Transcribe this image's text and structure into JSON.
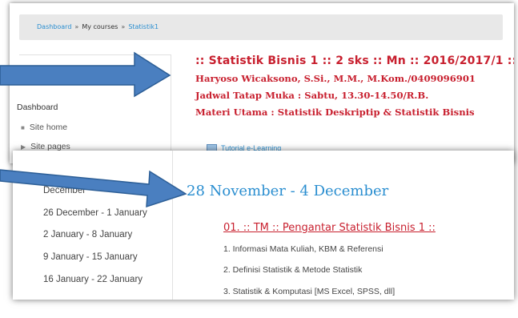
{
  "breadcrumb": {
    "items": [
      "Dashboard",
      "My courses",
      "Statistik1"
    ],
    "separator": "»"
  },
  "sidebar_top": {
    "title": "Dashboard",
    "items": [
      "Site home",
      "Site pages"
    ]
  },
  "course_header": {
    "title": ":: Statistik Bisnis 1 :: 2 sks :: Mn :: 2016/2017/1 ::",
    "lecturer": "Haryoso Wicaksono, S.Si., M.M., M.Kom./0409096901",
    "schedule": "Jadwal Tatap Muka : Sabtu, 13.30-14.50/R.B.",
    "material": "Materi Utama : Statistik Deskriptip & Statistik Bisnis"
  },
  "resource_link": "Tutorial e-Learning",
  "sidebar_weeks": [
    "December",
    "26 December - 1 January",
    "2 January - 8 January",
    "9 January - 15 January",
    "16 January - 22 January"
  ],
  "section": {
    "title": "28 November - 4 December",
    "topic": "01. :: TM :: Pengantar Statistik Bisnis 1 ::",
    "lines": [
      "1. Informasi Mata Kuliah, KBM & Referensi",
      "2. Definisi Statistik & Metode Statistik",
      "3. Statistik & Komputasi [MS Excel, SPSS, dll]"
    ]
  },
  "colors": {
    "accent_blue": "#2a8ed0",
    "heading_red": "#c8202f",
    "arrow_fill": "#4a7fc0"
  },
  "icons": [
    "bullet-icon",
    "chevron-right-icon",
    "document-icon",
    "arrow-right-icon"
  ]
}
